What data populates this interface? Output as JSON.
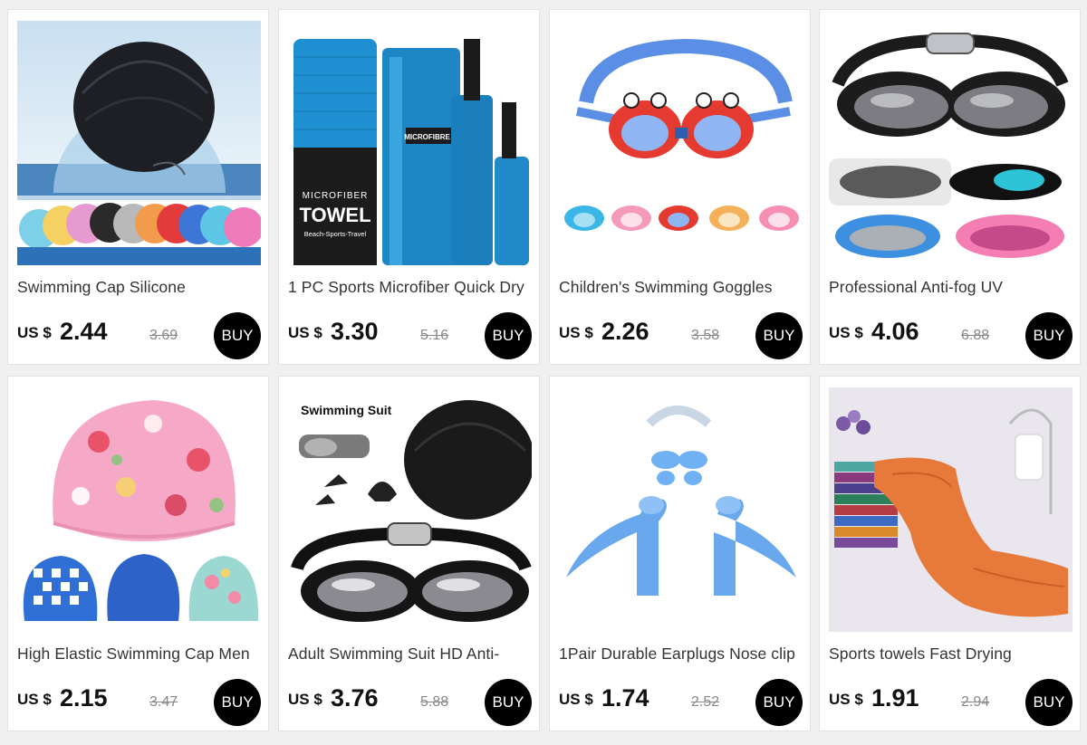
{
  "currency_label": "US $",
  "buy_label": "BUY",
  "products": [
    {
      "title": "Swimming Cap Silicone",
      "price": "2.44",
      "original_price": "3.69",
      "image_icon": "swim-cap-image"
    },
    {
      "title": "1 PC Sports Microfiber Quick Dry",
      "price": "3.30",
      "original_price": "5.16",
      "image_icon": "towel-bag-image",
      "image_text": [
        "MICROFIBER",
        "TOWEL",
        "Beach-Sports-Travel",
        "MICROFIBRE TOWEL"
      ]
    },
    {
      "title": "Children's Swimming Goggles",
      "price": "2.26",
      "original_price": "3.58",
      "image_icon": "kids-goggles-image"
    },
    {
      "title": "Professional  Anti-fog UV",
      "price": "4.06",
      "original_price": "6.88",
      "image_icon": "pro-goggles-image"
    },
    {
      "title": "High Elastic Swimming Cap Men",
      "price": "2.15",
      "original_price": "3.47",
      "image_icon": "fabric-cap-image"
    },
    {
      "title": "Adult Swimming Suit HD Anti-",
      "price": "3.76",
      "original_price": "5.88",
      "image_icon": "swim-suit-set-image",
      "image_text": [
        "Swimming Suit"
      ]
    },
    {
      "title": "1Pair Durable Earplugs Nose clip",
      "price": "1.74",
      "original_price": "2.52",
      "image_icon": "earplugs-image"
    },
    {
      "title": "Sports towels Fast Drying",
      "price": "1.91",
      "original_price": "2.94",
      "image_icon": "sports-towel-image"
    }
  ]
}
